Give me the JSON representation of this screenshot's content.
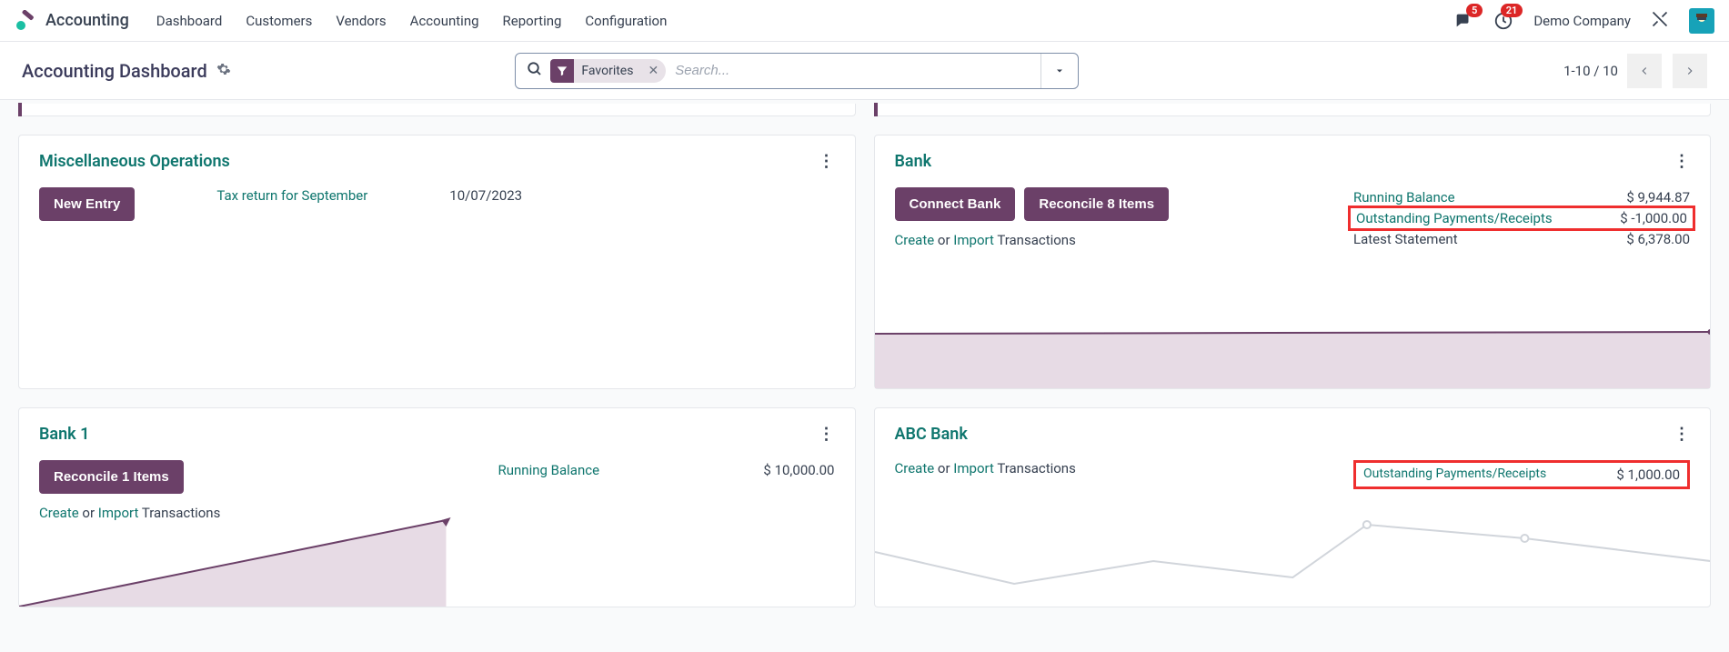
{
  "header": {
    "app_name": "Accounting",
    "menu": [
      "Dashboard",
      "Customers",
      "Vendors",
      "Accounting",
      "Reporting",
      "Configuration"
    ],
    "discuss_badge": "5",
    "activity_badge": "21",
    "company": "Demo Company"
  },
  "controlbar": {
    "title": "Accounting Dashboard",
    "filter_label": "Favorites",
    "search_placeholder": "Search...",
    "pager": "1-10 / 10"
  },
  "cards": {
    "misc": {
      "title": "Miscellaneous Operations",
      "new_entry": "New Entry",
      "tax_link": "Tax return for September",
      "tax_date": "10/07/2023"
    },
    "bank": {
      "title": "Bank",
      "connect": "Connect Bank",
      "reconcile": "Reconcile 8 Items",
      "create": "Create",
      "or": "or",
      "import": "Import",
      "transactions": "Transactions",
      "running_balance_label": "Running Balance",
      "running_balance_value": "$ 9,944.87",
      "outstanding_label": "Outstanding Payments/Receipts",
      "outstanding_value": "$ -1,000.00",
      "latest_label": "Latest Statement",
      "latest_value": "$ 6,378.00"
    },
    "bank1": {
      "title": "Bank 1",
      "reconcile": "Reconcile 1 Items",
      "create": "Create",
      "or": "or",
      "import": "Import",
      "transactions": "Transactions",
      "running_balance_label": "Running Balance",
      "running_balance_value": "$ 10,000.00"
    },
    "abc": {
      "title": "ABC Bank",
      "create": "Create",
      "or": "or",
      "import": "Import",
      "transactions": "Transactions",
      "outstanding_label": "Outstanding Payments/Receipts",
      "outstanding_value": "$ 1,000.00"
    }
  }
}
